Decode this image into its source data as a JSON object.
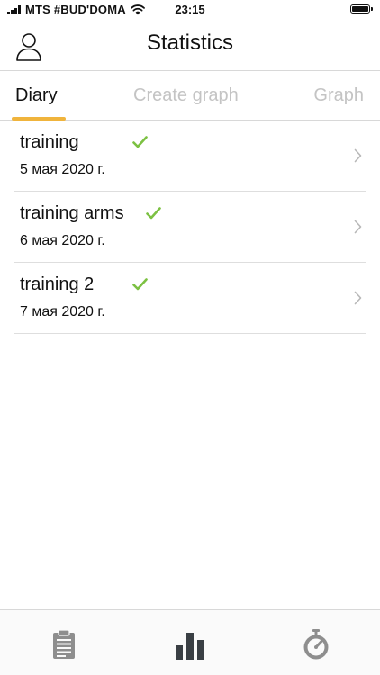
{
  "status_bar": {
    "carrier": "MTS #BUD'DOMA",
    "time": "23:15"
  },
  "header": {
    "title": "Statistics",
    "profile_icon": "person-icon"
  },
  "tabs": [
    {
      "label": "Diary",
      "active": true
    },
    {
      "label": "Create graph",
      "active": false
    },
    {
      "label": "Graph",
      "active": false
    }
  ],
  "entries": [
    {
      "title": "training",
      "date": "5 мая 2020 г.",
      "completed": true
    },
    {
      "title": "training arms",
      "date": "6 мая 2020 г.",
      "completed": true
    },
    {
      "title": "training 2",
      "date": "7 мая 2020 г.",
      "completed": true
    }
  ],
  "tab_bar": {
    "items": [
      {
        "icon": "clipboard-icon",
        "active": false
      },
      {
        "icon": "bar-chart-icon",
        "active": true
      },
      {
        "icon": "stopwatch-icon",
        "active": false
      }
    ]
  },
  "colors": {
    "accent": "#f0b43c",
    "check": "#7cc142",
    "inactive_tab_text": "#c4c4c4",
    "inactive_icon": "#8e8e8e",
    "active_icon": "#3a3f44"
  }
}
